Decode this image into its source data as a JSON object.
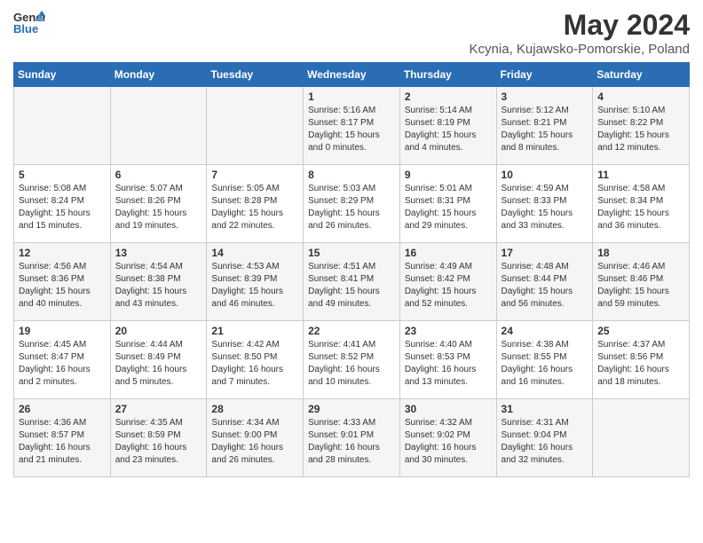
{
  "header": {
    "logo_general": "General",
    "logo_blue": "Blue",
    "title": "May 2024",
    "subtitle": "Kcynia, Kujawsko-Pomorskie, Poland"
  },
  "calendar": {
    "days_of_week": [
      "Sunday",
      "Monday",
      "Tuesday",
      "Wednesday",
      "Thursday",
      "Friday",
      "Saturday"
    ],
    "weeks": [
      [
        {
          "day": "",
          "text": ""
        },
        {
          "day": "",
          "text": ""
        },
        {
          "day": "",
          "text": ""
        },
        {
          "day": "1",
          "text": "Sunrise: 5:16 AM\nSunset: 8:17 PM\nDaylight: 15 hours\nand 0 minutes."
        },
        {
          "day": "2",
          "text": "Sunrise: 5:14 AM\nSunset: 8:19 PM\nDaylight: 15 hours\nand 4 minutes."
        },
        {
          "day": "3",
          "text": "Sunrise: 5:12 AM\nSunset: 8:21 PM\nDaylight: 15 hours\nand 8 minutes."
        },
        {
          "day": "4",
          "text": "Sunrise: 5:10 AM\nSunset: 8:22 PM\nDaylight: 15 hours\nand 12 minutes."
        }
      ],
      [
        {
          "day": "5",
          "text": "Sunrise: 5:08 AM\nSunset: 8:24 PM\nDaylight: 15 hours\nand 15 minutes."
        },
        {
          "day": "6",
          "text": "Sunrise: 5:07 AM\nSunset: 8:26 PM\nDaylight: 15 hours\nand 19 minutes."
        },
        {
          "day": "7",
          "text": "Sunrise: 5:05 AM\nSunset: 8:28 PM\nDaylight: 15 hours\nand 22 minutes."
        },
        {
          "day": "8",
          "text": "Sunrise: 5:03 AM\nSunset: 8:29 PM\nDaylight: 15 hours\nand 26 minutes."
        },
        {
          "day": "9",
          "text": "Sunrise: 5:01 AM\nSunset: 8:31 PM\nDaylight: 15 hours\nand 29 minutes."
        },
        {
          "day": "10",
          "text": "Sunrise: 4:59 AM\nSunset: 8:33 PM\nDaylight: 15 hours\nand 33 minutes."
        },
        {
          "day": "11",
          "text": "Sunrise: 4:58 AM\nSunset: 8:34 PM\nDaylight: 15 hours\nand 36 minutes."
        }
      ],
      [
        {
          "day": "12",
          "text": "Sunrise: 4:56 AM\nSunset: 8:36 PM\nDaylight: 15 hours\nand 40 minutes."
        },
        {
          "day": "13",
          "text": "Sunrise: 4:54 AM\nSunset: 8:38 PM\nDaylight: 15 hours\nand 43 minutes."
        },
        {
          "day": "14",
          "text": "Sunrise: 4:53 AM\nSunset: 8:39 PM\nDaylight: 15 hours\nand 46 minutes."
        },
        {
          "day": "15",
          "text": "Sunrise: 4:51 AM\nSunset: 8:41 PM\nDaylight: 15 hours\nand 49 minutes."
        },
        {
          "day": "16",
          "text": "Sunrise: 4:49 AM\nSunset: 8:42 PM\nDaylight: 15 hours\nand 52 minutes."
        },
        {
          "day": "17",
          "text": "Sunrise: 4:48 AM\nSunset: 8:44 PM\nDaylight: 15 hours\nand 56 minutes."
        },
        {
          "day": "18",
          "text": "Sunrise: 4:46 AM\nSunset: 8:46 PM\nDaylight: 15 hours\nand 59 minutes."
        }
      ],
      [
        {
          "day": "19",
          "text": "Sunrise: 4:45 AM\nSunset: 8:47 PM\nDaylight: 16 hours\nand 2 minutes."
        },
        {
          "day": "20",
          "text": "Sunrise: 4:44 AM\nSunset: 8:49 PM\nDaylight: 16 hours\nand 5 minutes."
        },
        {
          "day": "21",
          "text": "Sunrise: 4:42 AM\nSunset: 8:50 PM\nDaylight: 16 hours\nand 7 minutes."
        },
        {
          "day": "22",
          "text": "Sunrise: 4:41 AM\nSunset: 8:52 PM\nDaylight: 16 hours\nand 10 minutes."
        },
        {
          "day": "23",
          "text": "Sunrise: 4:40 AM\nSunset: 8:53 PM\nDaylight: 16 hours\nand 13 minutes."
        },
        {
          "day": "24",
          "text": "Sunrise: 4:38 AM\nSunset: 8:55 PM\nDaylight: 16 hours\nand 16 minutes."
        },
        {
          "day": "25",
          "text": "Sunrise: 4:37 AM\nSunset: 8:56 PM\nDaylight: 16 hours\nand 18 minutes."
        }
      ],
      [
        {
          "day": "26",
          "text": "Sunrise: 4:36 AM\nSunset: 8:57 PM\nDaylight: 16 hours\nand 21 minutes."
        },
        {
          "day": "27",
          "text": "Sunrise: 4:35 AM\nSunset: 8:59 PM\nDaylight: 16 hours\nand 23 minutes."
        },
        {
          "day": "28",
          "text": "Sunrise: 4:34 AM\nSunset: 9:00 PM\nDaylight: 16 hours\nand 26 minutes."
        },
        {
          "day": "29",
          "text": "Sunrise: 4:33 AM\nSunset: 9:01 PM\nDaylight: 16 hours\nand 28 minutes."
        },
        {
          "day": "30",
          "text": "Sunrise: 4:32 AM\nSunset: 9:02 PM\nDaylight: 16 hours\nand 30 minutes."
        },
        {
          "day": "31",
          "text": "Sunrise: 4:31 AM\nSunset: 9:04 PM\nDaylight: 16 hours\nand 32 minutes."
        },
        {
          "day": "",
          "text": ""
        }
      ]
    ]
  }
}
